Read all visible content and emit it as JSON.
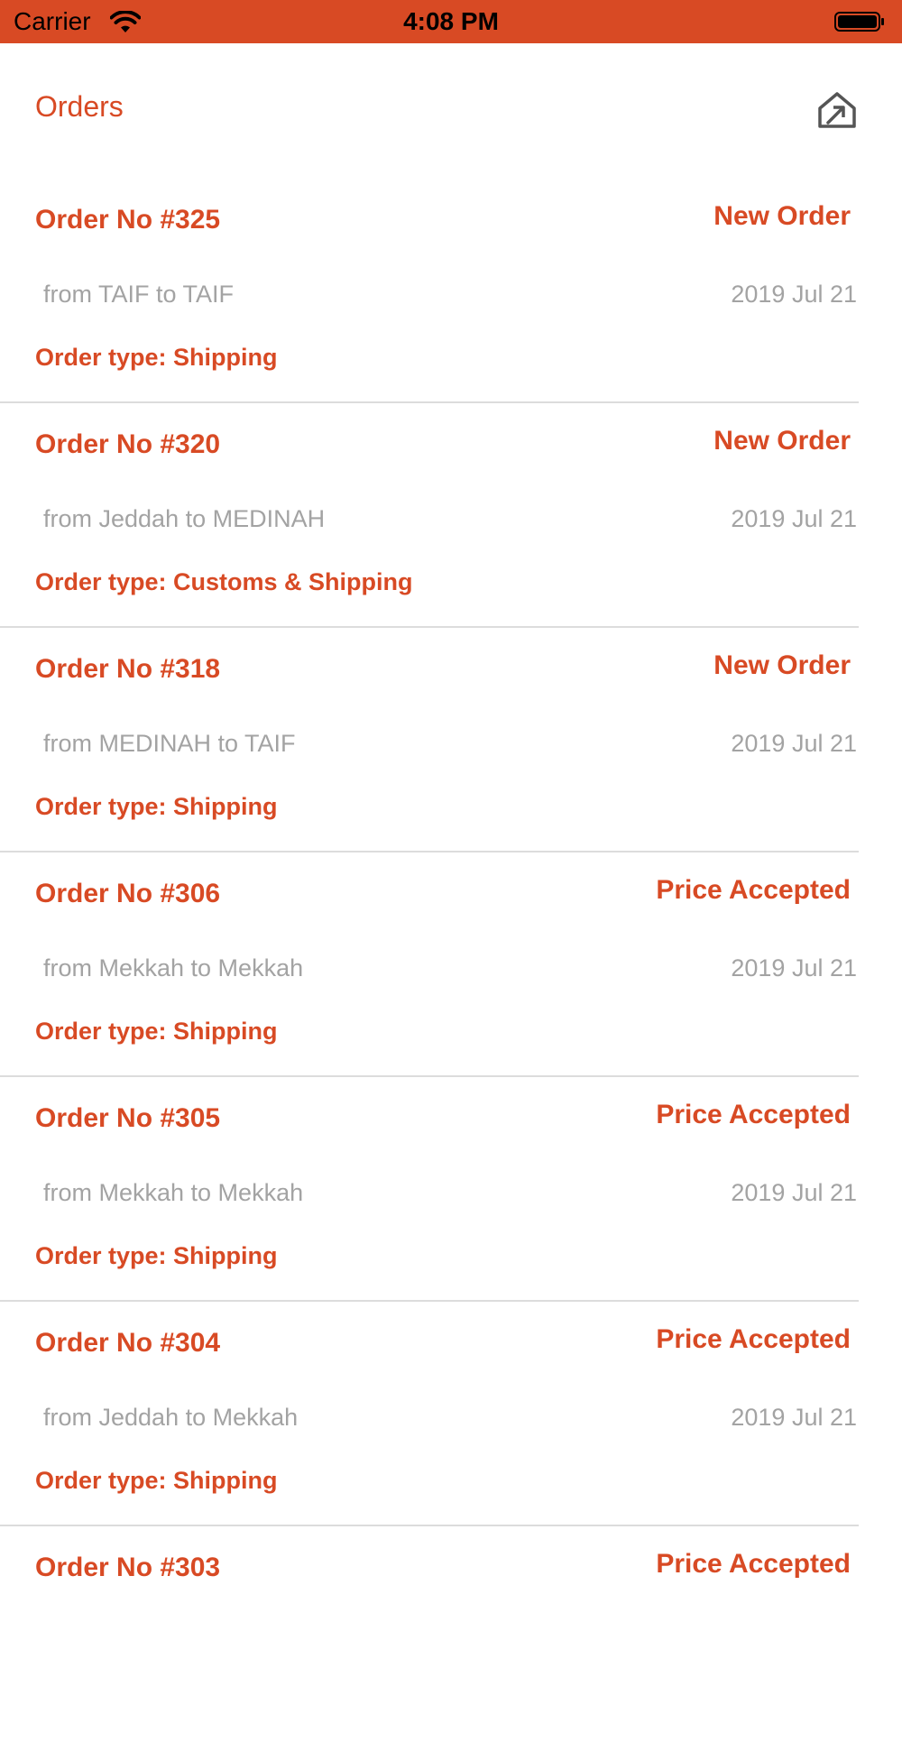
{
  "status_bar": {
    "carrier": "Carrier",
    "time": "4:08 PM"
  },
  "header": {
    "title": "Orders",
    "home_icon": "home-arrow-icon"
  },
  "colors": {
    "accent": "#d84a24",
    "muted_text": "#a3a3a3",
    "divider": "#dcdcdc"
  },
  "orders": [
    {
      "number": "Order No #325",
      "status": "New Order",
      "route": "from TAIF to TAIF",
      "date": "2019 Jul 21",
      "type": "Order type: Shipping"
    },
    {
      "number": "Order No #320",
      "status": "New Order",
      "route": "from Jeddah to MEDINAH",
      "date": "2019 Jul 21",
      "type": "Order type: Customs & Shipping"
    },
    {
      "number": "Order No #318",
      "status": "New Order",
      "route": "from MEDINAH to TAIF",
      "date": "2019 Jul 21",
      "type": "Order type: Shipping"
    },
    {
      "number": "Order No #306",
      "status": "Price Accepted",
      "route": "from Mekkah to Mekkah",
      "date": "2019 Jul 21",
      "type": "Order type: Shipping"
    },
    {
      "number": "Order No #305",
      "status": "Price Accepted",
      "route": "from Mekkah to Mekkah",
      "date": "2019 Jul 21",
      "type": "Order type: Shipping"
    },
    {
      "number": "Order No #304",
      "status": "Price Accepted",
      "route": "from Jeddah to Mekkah",
      "date": "2019 Jul 21",
      "type": "Order type: Shipping"
    },
    {
      "number": "Order No #303",
      "status": "Price Accepted"
    }
  ]
}
